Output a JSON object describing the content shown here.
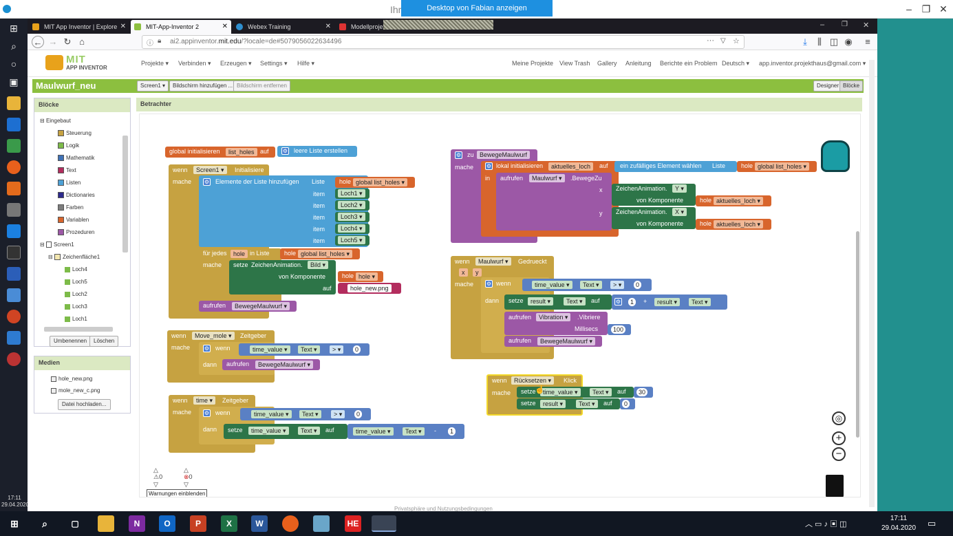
{
  "window": {
    "title": "Ihr",
    "share_banner": "Desktop von Fabian anzeigen"
  },
  "tabs": [
    {
      "label": "MIT App Inventor | Explore MIT",
      "color": "#e8a21b"
    },
    {
      "label": "MIT-App-Inventor 2",
      "color": "#8cbf3f"
    },
    {
      "label": "Webex Training",
      "color": "#2f8fcf"
    },
    {
      "label": "Modellprojekt",
      "color": "#d33"
    }
  ],
  "url": {
    "prefix": "ai2.appinventor.",
    "host": "mit.edu",
    "rest": "/?locale=de#5079056022634496"
  },
  "logo": {
    "mit": "MIT",
    "sub": "APP INVENTOR"
  },
  "menu": [
    "Projekte ▾",
    "Verbinden ▾",
    "Erzeugen ▾",
    "Settings ▾",
    "Hilfe ▾"
  ],
  "right_menu": [
    "Meine Projekte",
    "View Trash",
    "Gallery",
    "Anleitung",
    "Berichte ein Problem",
    "Deutsch ▾",
    "app.inventor.projekthaus@gmail.com ▾"
  ],
  "project": {
    "name": "Maulwurf_neu",
    "screen": "Screen1 ▾",
    "add_screen": "Bildschirm hinzufügen ...",
    "remove_screen": "Bildschirm entfernen",
    "designer": "Designer",
    "blocks": "Blöcke"
  },
  "blocks_panel": {
    "title": "Blöcke",
    "builtin": "Eingebaut",
    "categories": [
      {
        "label": "Steuerung",
        "color": "#c6a241"
      },
      {
        "label": "Logik",
        "color": "#7dbb49"
      },
      {
        "label": "Mathematik",
        "color": "#3f71b5"
      },
      {
        "label": "Text",
        "color": "#b32d5e"
      },
      {
        "label": "Listen",
        "color": "#4da1d6"
      },
      {
        "label": "Dictionaries",
        "color": "#2d2a8c"
      },
      {
        "label": "Farben",
        "color": "#7d7d7d"
      },
      {
        "label": "Variablen",
        "color": "#d8652c"
      },
      {
        "label": "Prozeduren",
        "color": "#9c58a6"
      }
    ],
    "screen": "Screen1",
    "canvas": "Zeichenfläche1",
    "sprites": [
      "Loch4",
      "Loch5",
      "Loch2",
      "Loch3",
      "Loch1"
    ],
    "rename": "Umbenennen",
    "delete": "Löschen"
  },
  "media": {
    "title": "Medien",
    "files": [
      "hole_new.png",
      "mole_new_c.png"
    ],
    "upload": "Datei hochladen..."
  },
  "viewer": {
    "title": "Betrachter"
  },
  "workspace": {
    "init_global": "global initialisieren",
    "list_holes": "list_holes",
    "auf": "auf",
    "leere_liste": "leere Liste erstellen",
    "wenn": "wenn",
    "mache": "mache",
    "dann": "dann",
    "in": "in",
    "zu": "zu",
    "screen1": "Screen1 ▾",
    "initialisiere": "Initialisiere",
    "elemente_hinzufuegen": "Elemente der Liste hinzufügen",
    "liste": "Liste",
    "hole": "hole",
    "global_list_holes": "global list_holes ▾",
    "item": "item",
    "loch_items": [
      "Loch1 ▾",
      "Loch2 ▾",
      "Loch3 ▾",
      "Loch4 ▾",
      "Loch5 ▾"
    ],
    "fuer_jedes": "für jedes",
    "hole_var": "hole",
    "in_liste": "in Liste",
    "setze": "setze",
    "zeichenanimation_bild": "ZeichenAnimation.",
    "bild": "Bild ▾",
    "von_komponente": "von Komponente",
    "hole_dd": "hole ▾",
    "hole_new_png": "hole_new.png",
    "aufrufen": "aufrufen",
    "bewege_maulwurf": "BewegeMaulwurf ▾",
    "bewege_maulwurf_plain": "BewegeMaulwurf",
    "move_mole": "Move_mole ▾",
    "zeitgeber": "Zeitgeber",
    "time_value": "time_value ▾",
    "text_dd": "Text ▾",
    "gt": "> ▾",
    "zero": "0",
    "time_dd": "time ▾",
    "minus": "-",
    "one": "1",
    "lokal_init": "lokal initialisieren",
    "aktuelles_loch": "aktuelles_loch",
    "zufaelliges": "ein zufälliges Element wählen",
    "maulwurf_dd": "Maulwurf ▾",
    "bewegezu": ".BewegeZu",
    "x": "x",
    "y": "y",
    "y_dd": "Y ▾",
    "x_dd": "X ▾",
    "hole_aktuelles_loch": "aktuelles_loch ▾",
    "maulwurf_gedrueckt": "Gedrueckt",
    "result": "result ▾",
    "plus": "+",
    "vibration": "Vibration ▾",
    "vibriere": ".Vibriere",
    "millisecs": "Millisecs",
    "hundred": "100",
    "ruecksetzen": "Rücksetzen ▾",
    "klick": "Klick",
    "thirty": "30",
    "warn_count": "0",
    "error_count": "0",
    "warnings_btn": "Warnungen einblenden"
  },
  "footer_text": "Privatsphäre und Nutzungsbedingungen",
  "left_bar_time": {
    "time": "17:11",
    "date": "29.04.2020"
  },
  "taskbar": {
    "time": "17:11",
    "date": "29.04.2020"
  }
}
